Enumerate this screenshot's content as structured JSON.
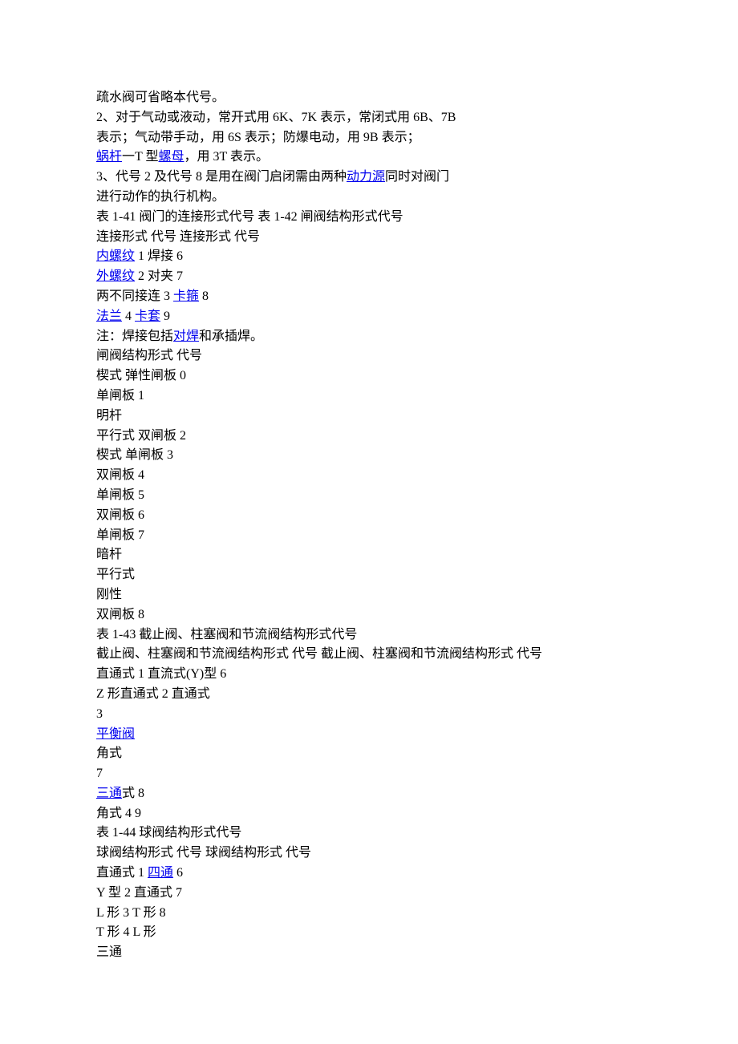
{
  "lines": [
    [
      {
        "t": "疏水阀可省略本代号。"
      }
    ],
    [
      {
        "t": "2、对于气动或液动，常开式用 6K、7K 表示，常闭式用 6B、7B"
      }
    ],
    [
      {
        "t": "表示；气动带手动，用 6S 表示；防爆电动，用 9B 表示；"
      }
    ],
    [
      {
        "t": "蜗杆",
        "link": true
      },
      {
        "t": "一T 型"
      },
      {
        "t": "螺母",
        "link": true
      },
      {
        "t": "，用 3T 表示。"
      }
    ],
    [
      {
        "t": "3、代号 2 及代号 8 是用在阀门启闭需由两种"
      },
      {
        "t": "动力源",
        "link": true
      },
      {
        "t": "同时对阀门"
      }
    ],
    [
      {
        "t": "进行动作的执行机构。"
      }
    ],
    [
      {
        "t": "表 1-41 阀门的连接形式代号 表 1-42 闸阀结构形式代号"
      }
    ],
    [
      {
        "t": "连接形式 代号 连接形式 代号"
      }
    ],
    [
      {
        "t": "内螺纹",
        "link": true
      },
      {
        "t": " 1 焊接 6"
      }
    ],
    [
      {
        "t": "外螺纹",
        "link": true
      },
      {
        "t": " 2 对夹 7"
      }
    ],
    [
      {
        "t": "两不同接连 3 "
      },
      {
        "t": "卡箍",
        "link": true
      },
      {
        "t": " 8"
      }
    ],
    [
      {
        "t": "法兰",
        "link": true
      },
      {
        "t": " 4 "
      },
      {
        "t": "卡套",
        "link": true
      },
      {
        "t": " 9"
      }
    ],
    [
      {
        "t": "注：焊接包括"
      },
      {
        "t": "对焊",
        "link": true
      },
      {
        "t": "和承插焊。"
      }
    ],
    [
      {
        "t": "闸阀结构形式 代号"
      }
    ],
    [
      {
        "t": "楔式 弹性闸板 0"
      }
    ],
    [
      {
        "t": "单闸板 1"
      }
    ],
    [
      {
        "t": "明杆"
      }
    ],
    [
      {
        "t": "平行式 双闸板 2"
      }
    ],
    [
      {
        "t": "楔式 单闸板 3"
      }
    ],
    [
      {
        "t": "双闸板 4"
      }
    ],
    [
      {
        "t": "单闸板 5"
      }
    ],
    [
      {
        "t": "双闸板 6"
      }
    ],
    [
      {
        "t": "单闸板 7"
      }
    ],
    [
      {
        "t": "暗杆"
      }
    ],
    [
      {
        "t": "平行式"
      }
    ],
    [
      {
        "t": "刚性"
      }
    ],
    [
      {
        "t": "双闸板 8"
      }
    ],
    [
      {
        "t": "表 1-43 截止阀、柱塞阀和节流阀结构形式代号"
      }
    ],
    [
      {
        "t": "截止阀、柱塞阀和节流阀结构形式 代号 截止阀、柱塞阀和节流阀结构形式 代号"
      }
    ],
    [
      {
        "t": "直通式 1 直流式(Y)型 6"
      }
    ],
    [
      {
        "t": "Z 形直通式 2 直通式"
      }
    ],
    [
      {
        "t": "3"
      }
    ],
    [
      {
        "t": "平衡阀",
        "link": true
      }
    ],
    [
      {
        "t": "角式"
      }
    ],
    [
      {
        "t": "7"
      }
    ],
    [
      {
        "t": "三通",
        "link": true
      },
      {
        "t": "式 8"
      }
    ],
    [
      {
        "t": "角式 4 9"
      }
    ],
    [
      {
        "t": "表 1-44 球阀结构形式代号"
      }
    ],
    [
      {
        "t": "球阀结构形式 代号 球阀结构形式 代号"
      }
    ],
    [
      {
        "t": "直通式 1 "
      },
      {
        "t": "四通",
        "link": true
      },
      {
        "t": " 6"
      }
    ],
    [
      {
        "t": "Y 型 2 直通式 7"
      }
    ],
    [
      {
        "t": "L 形 3 T 形 8"
      }
    ],
    [
      {
        "t": "T 形 4 L 形"
      }
    ],
    [
      {
        "t": "三通"
      }
    ]
  ]
}
